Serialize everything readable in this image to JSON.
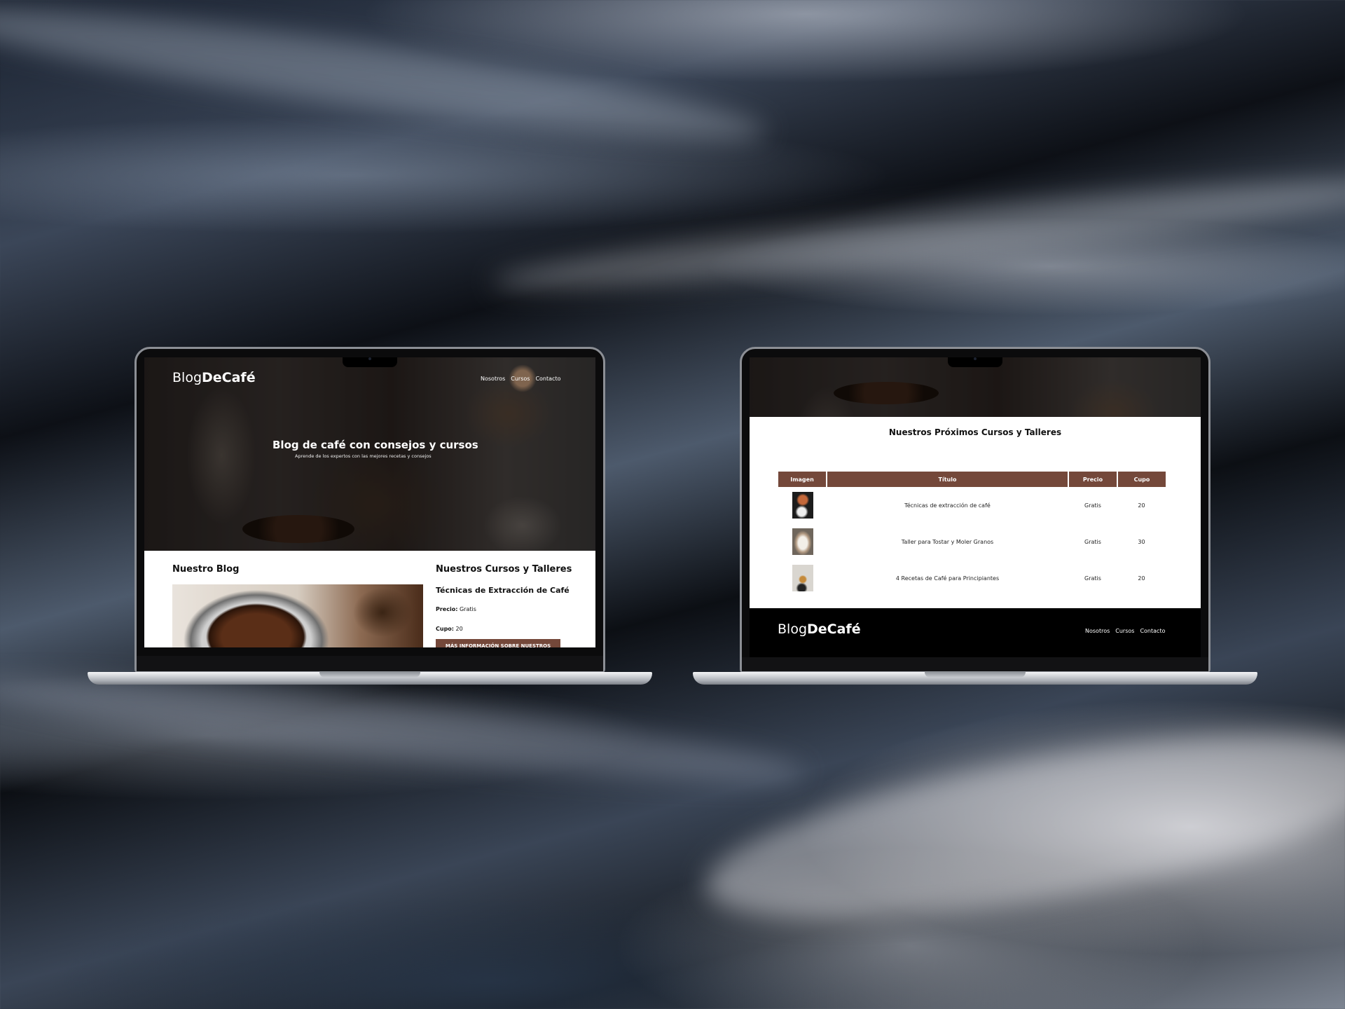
{
  "site": {
    "logo_light": "Blog",
    "logo_bold": "DeCafé",
    "nav": [
      "Nosotros",
      "Cursos",
      "Contacto"
    ]
  },
  "home": {
    "hero_title": "Blog de café con consejos y cursos",
    "hero_subtitle": "Aprende de los expertos con las mejores recetas y consejos",
    "blog_heading": "Nuestro Blog",
    "courses_heading": "Nuestros Cursos y Talleres",
    "course_title": "Técnicas de Extracción de Café",
    "price_label": "Precio:",
    "price_value": "Gratis",
    "quota_label": "Cupo:",
    "quota_value": "20",
    "more_button": "MÁS INFORMACIÓN SOBRE NUESTROS"
  },
  "courses": {
    "heading": "Nuestros Próximos Cursos y Talleres",
    "columns": [
      "Imagen",
      "Título",
      "Precio",
      "Cupo"
    ],
    "rows": [
      {
        "title": "Técnicas de extracción de café",
        "price": "Gratis",
        "quota": "20"
      },
      {
        "title": "Taller para Tostar y Moler Granos",
        "price": "Gratis",
        "quota": "30"
      },
      {
        "title": "4 Recetas de Café para Principiantes",
        "price": "Gratis",
        "quota": "20"
      }
    ]
  },
  "colors": {
    "accent": "#74483a",
    "footer": "#000000"
  }
}
